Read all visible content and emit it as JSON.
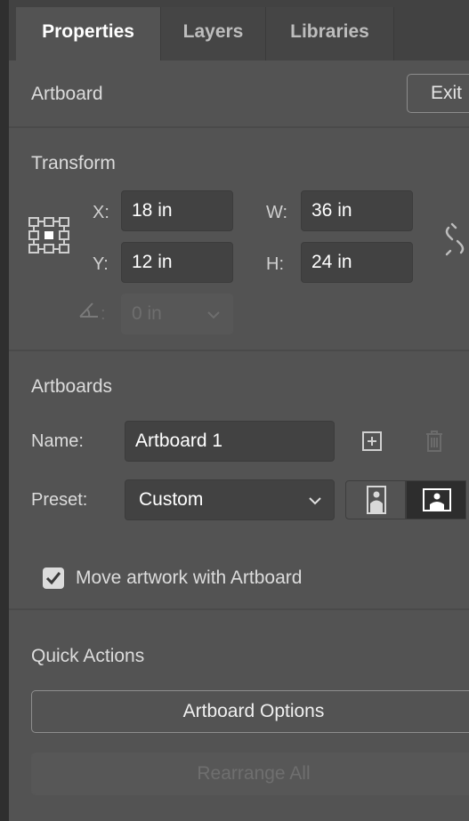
{
  "tabs": [
    {
      "label": "Properties",
      "active": true
    },
    {
      "label": "Layers",
      "active": false
    },
    {
      "label": "Libraries",
      "active": false
    }
  ],
  "artboard_header": {
    "title": "Artboard",
    "exit_label": "Exit"
  },
  "transform": {
    "title": "Transform",
    "x_label": "X:",
    "x_value": "18 in",
    "y_label": "Y:",
    "y_value": "12 in",
    "w_label": "W:",
    "w_value": "36 in",
    "h_label": "H:",
    "h_value": "24 in",
    "angle_label": ":",
    "angle_value": "0 in"
  },
  "artboards": {
    "title": "Artboards",
    "name_label": "Name:",
    "name_value": "Artboard 1",
    "preset_label": "Preset:",
    "preset_value": "Custom",
    "move_artwork_label": "Move artwork with Artboard",
    "move_artwork_checked": true
  },
  "quick_actions": {
    "title": "Quick Actions",
    "artboard_options_label": "Artboard Options",
    "rearrange_label": "Rearrange All"
  },
  "colors": {
    "panel": "#535353",
    "field": "#424242",
    "text": "#d6d6d6"
  },
  "icons": [
    "reference-point-icon",
    "constrain-proportions-icon",
    "add-artboard-icon",
    "delete-artboard-icon",
    "portrait-icon",
    "landscape-icon",
    "checkmark-icon",
    "chevron-down-icon",
    "angle-icon"
  ]
}
